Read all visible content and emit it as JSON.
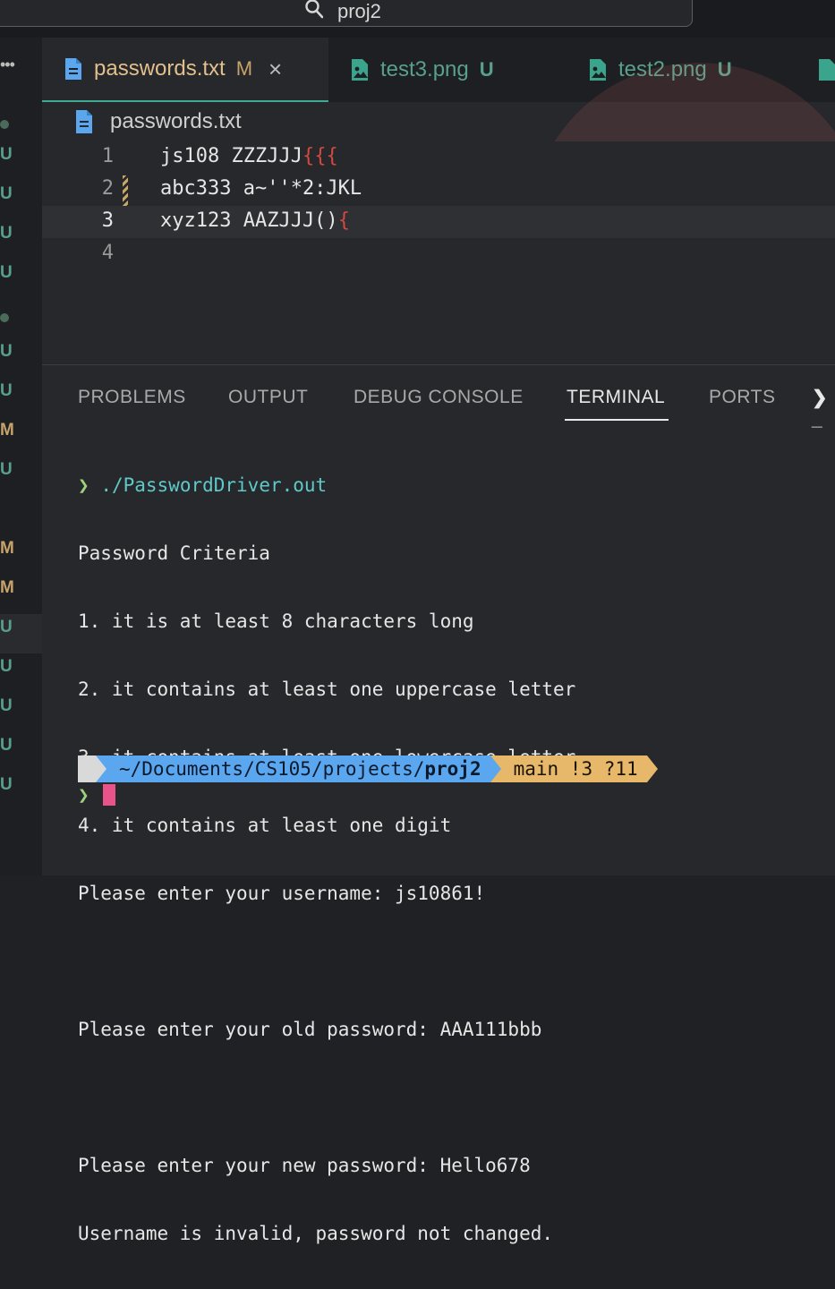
{
  "search": {
    "text": "proj2"
  },
  "leftbar": {
    "dots": "•••",
    "marks": [
      "•",
      "U",
      "U",
      "U",
      "U",
      "•",
      "U",
      "U",
      "M",
      "U",
      "M",
      "M",
      "U",
      "U",
      "U",
      "U",
      "U"
    ]
  },
  "tabs": [
    {
      "name": "passwords.txt",
      "badge": "M",
      "close": "×",
      "active": true
    },
    {
      "name": "test3.png",
      "badge": "U",
      "active": false
    },
    {
      "name": "test2.png",
      "badge": "U",
      "active": false
    }
  ],
  "breadcrumb": {
    "file": "passwords.txt"
  },
  "editor": {
    "lines": [
      {
        "num": "1",
        "text": "js108 ZZZJJJ",
        "bracket": "{{{"
      },
      {
        "num": "2",
        "text": "abc333 a~''*2:JKL",
        "bracket": ""
      },
      {
        "num": "3",
        "text": "xyz123 AAZJJJ()",
        "bracket": "{"
      },
      {
        "num": "4",
        "text": "",
        "bracket": ""
      }
    ]
  },
  "panel": {
    "tabs": [
      "PROBLEMS",
      "OUTPUT",
      "DEBUG CONSOLE",
      "TERMINAL",
      "PORTS"
    ],
    "active_tab": "TERMINAL",
    "overflow": "❯_"
  },
  "terminal": {
    "prompt": "❯",
    "command": "./PasswordDriver.out",
    "lines": [
      "Password Criteria",
      "1. it is at least 8 characters long",
      "2. it contains at least one uppercase letter",
      "3. it contains at least one lowercase letter",
      "4. it contains at least one digit",
      "Please enter your username: js10861!",
      "",
      "Please enter your old password: AAA111bbb",
      "",
      "Please enter your new password: Hello678",
      "Username is invalid, password not changed."
    ],
    "powerline": {
      "os": "",
      "path_prefix": " ~/Documents/CS105/projects/",
      "path_bold": "proj2",
      "git": "  main !3 ?11"
    }
  },
  "colors": {
    "accent": "#3fa994",
    "untracked": "#58a08a",
    "modified": "#c7a36a",
    "cursor": "#e8538a"
  }
}
